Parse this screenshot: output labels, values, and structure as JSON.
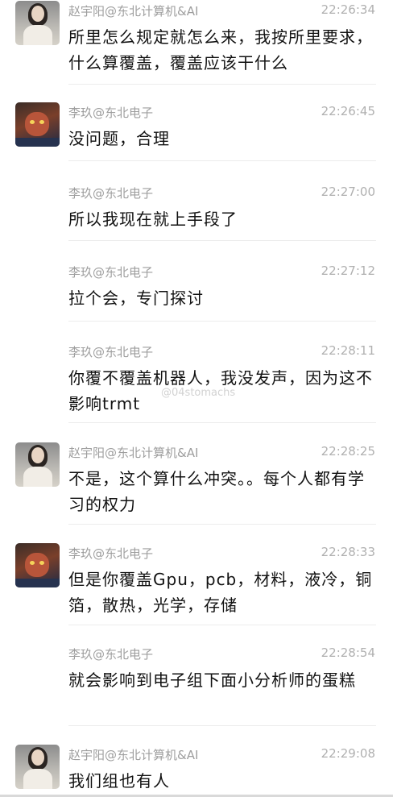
{
  "messages": [
    {
      "sender": "赵宇阳@东北计算机&AI",
      "time": "22:26:34",
      "text": "所里怎么规定就怎么来，我按所里要求，什么算覆盖，覆盖应该干什么",
      "avatar": "avatar-zhao"
    },
    {
      "sender": "李玖@东北电子",
      "time": "22:26:45",
      "text": "没问题，合理",
      "avatar": "avatar-li"
    },
    {
      "sender": "李玖@东北电子",
      "time": "22:27:00",
      "text": "所以我现在就上手段了",
      "avatar": ""
    },
    {
      "sender": "李玖@东北电子",
      "time": "22:27:12",
      "text": "拉个会，专门探讨",
      "avatar": ""
    },
    {
      "sender": "李玖@东北电子",
      "time": "22:28:11",
      "text": "你覆不覆盖机器人，我没发声，因为这不影响trmt",
      "avatar": ""
    },
    {
      "sender": "赵宇阳@东北计算机&AI",
      "time": "22:28:25",
      "text": "不是，这个算什么冲突。。每个人都有学习的权力",
      "avatar": "avatar-zhao"
    },
    {
      "sender": "李玖@东北电子",
      "time": "22:28:33",
      "text": "但是你覆盖Gpu，pcb，材料，液冷，铜箔，散热，光学，存储",
      "avatar": "avatar-li"
    },
    {
      "sender": "李玖@东北电子",
      "time": "22:28:54",
      "text": "就会影响到电子组下面小分析师的蛋糕",
      "avatar": ""
    },
    {
      "sender": "赵宇阳@东北计算机&AI",
      "time": "22:29:08",
      "text": "我们组也有人",
      "avatar": "avatar-zhao"
    }
  ],
  "watermark": "@04stomachs"
}
